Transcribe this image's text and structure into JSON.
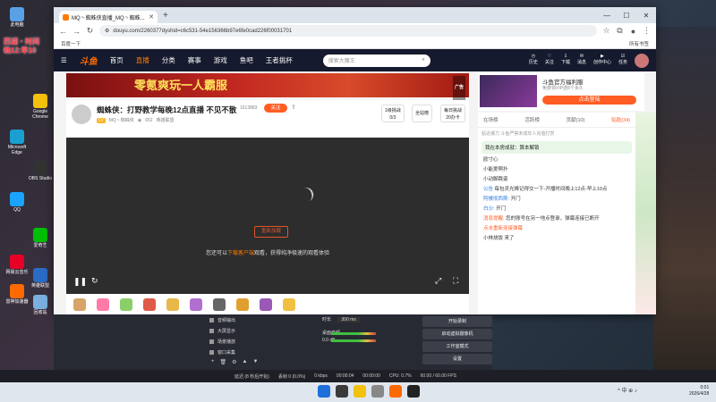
{
  "desktop": {
    "promo_text": "西湖・时间\n晚12:早10",
    "icons": [
      {
        "label": "此电脑",
        "color": "#5aa0e6"
      },
      {
        "label": "Google\nChrome",
        "color": "#f4c20d"
      },
      {
        "label": "Microsoft\nEdge",
        "color": "#1a9fd1"
      },
      {
        "label": "OBS Studio",
        "color": "#333"
      },
      {
        "label": "QQ",
        "color": "#1aa3ff"
      },
      {
        "label": "爱奇艺",
        "color": "#00be06"
      },
      {
        "label": "网易云音乐",
        "color": "#e60026"
      },
      {
        "label": "英雄联盟",
        "color": "#2a6bc6"
      },
      {
        "label": "雷神加速器",
        "color": "#ff6a00"
      },
      {
        "label": "回收站",
        "color": "#7ab0e0"
      }
    ]
  },
  "browser": {
    "tab_title": "MQ丶蜘蛛侠直播_MQ丶蜘蛛...",
    "url": "douyu.com/2260377dyshid=c6c531-54e156366b97e6fe0cad226f00031701",
    "bookmark_left": "百度一下",
    "bookmark_right": "所有书签"
  },
  "douyu": {
    "logo": "斗鱼",
    "nav": [
      "首页",
      "直播",
      "分类",
      "赛事",
      "游戏",
      "鱼吧",
      "王者挑杯"
    ],
    "active_nav": "直播",
    "search_placeholder": "搜索大魔王",
    "right_items": [
      "历史",
      "关注",
      "下载",
      "消息",
      "创作中心",
      "任务"
    ],
    "banner_text": "零氪爽玩一人霸服",
    "ad_tag": "广告",
    "room": {
      "title": "蜘蛛侠：打野教学每晚12点直播 不见不散",
      "room_id": "1613883",
      "follow": "关注",
      "level": "LV",
      "streamer": "MQ丶蜘蛛侠",
      "viewers": "652",
      "category": "英雄联盟",
      "tasks": [
        {
          "label": "1级挑战\n0/3"
        },
        {
          "label": "全站榜"
        },
        {
          "label": "每日挑战\n20办卡"
        }
      ]
    },
    "player": {
      "reload_label": "重新加载",
      "message_prefix": "您还可以",
      "message_highlight": "下载客户端",
      "message_suffix": "观看，获得纯净极速的观看体验"
    },
    "side_ad": {
      "title": "斗鱼官方福利服",
      "subtitle": "免费领VIP送8个永久",
      "button": "点击登陆",
      "tag": "广告"
    },
    "chat": {
      "tabs": [
        "在场榜",
        "活跃榜",
        "贡献(10)",
        "贴脸(34)"
      ],
      "active_tab": "贴脸(34)",
      "rank_hint": "贴近爆力  斗鱼严禁未成年人充值打赏",
      "notice": "我在本房成就：算本解锁",
      "messages": [
        {
          "name": "",
          "text": "欧寸心"
        },
        {
          "name": "",
          "text": "小能爱啊扑"
        },
        {
          "name": "",
          "text": "小动脚跳姿"
        },
        {
          "name": "公告",
          "text": "每包灵光捧记得交一下-开播时间晚上12点-早上10点"
        },
        {
          "name": "阿楼彻西斯:",
          "text": "开门"
        },
        {
          "name": "白沙:",
          "text": "开门"
        },
        {
          "name": "消息提醒:",
          "text": "您的账号在另一地点登录，弹幕连接已断开"
        },
        {
          "name": "",
          "text": "点击重新连接弹幕"
        },
        {
          "name": "",
          "text": "小林烧饭 来了"
        }
      ]
    },
    "gifts": [
      {
        "color": "#d9a46a"
      },
      {
        "color": "#ff7aa8"
      },
      {
        "color": "#8ad06a"
      },
      {
        "color": "#e05a4a"
      },
      {
        "color": "#e8b84a"
      },
      {
        "color": "#b070d0"
      },
      {
        "color": "#666"
      },
      {
        "color": "#e0a030"
      },
      {
        "color": "#9b59b6"
      },
      {
        "color": "#f0c040"
      }
    ]
  },
  "obs": {
    "sources": [
      "音频输出",
      "大屏显示",
      "场景播放",
      "窗口采集"
    ],
    "mixer_header": "时长",
    "mixer_value": "300 ms",
    "mixer_label": "桌面音频",
    "db_value": "0.0 dB",
    "buttons": [
      "开始录制",
      "启动虚拟摄像机",
      "工作室模式",
      "设置"
    ],
    "status": [
      "延迟 (8 秒后开始)",
      "丢帧 0 (0.0%)",
      "0 kbps",
      "00:00:04",
      "00:00:00",
      "CPU: 0.7%",
      "60.00 / 60.00 FPS"
    ]
  },
  "taskbar": {
    "apps": [
      {
        "color": "#1e6fd9"
      },
      {
        "color": "#3a3a3a"
      },
      {
        "color": "#f4c20d"
      },
      {
        "color": "#888"
      },
      {
        "color": "#ff6a00"
      },
      {
        "color": "#222"
      }
    ],
    "tray": "^ 中 ⊕ ♪",
    "time": "0:01",
    "date": "2026/4/28"
  }
}
